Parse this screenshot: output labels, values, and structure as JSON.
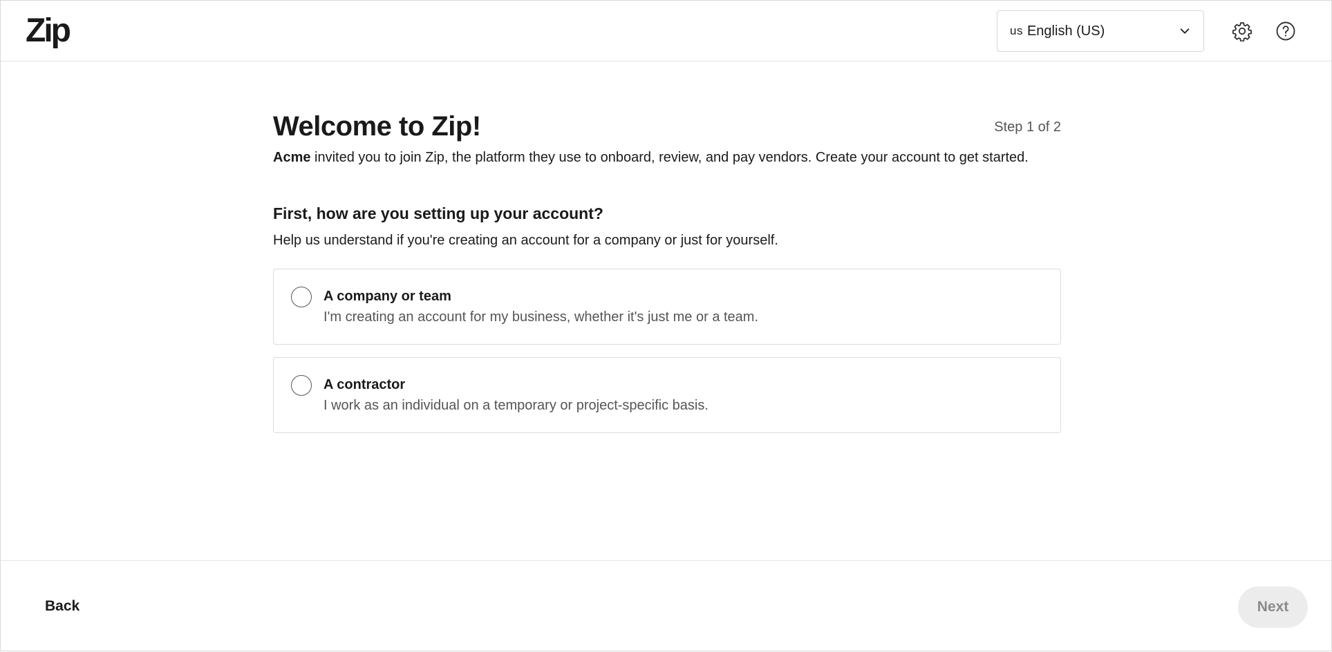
{
  "header": {
    "logo_text": "Zip",
    "language": {
      "flag": "us",
      "selected": "English (US)"
    },
    "settings_icon": "gear-icon",
    "help_icon": "question-circle-icon"
  },
  "main": {
    "title": "Welcome to Zip!",
    "step": "Step 1 of 2",
    "intro_company": "Acme",
    "intro_text": " invited you to join Zip, the platform they use to onboard, review, and pay vendors. Create your account to get started.",
    "question": "First, how are you setting up your account?",
    "question_help": "Help us understand if you're creating an account for a company or just for yourself.",
    "options": [
      {
        "title": "A company or team",
        "description": "I'm creating an account for my business, whether it's just me or a team.",
        "selected": false
      },
      {
        "title": "A contractor",
        "description": "I work as an individual on a temporary or project-specific basis.",
        "selected": false
      }
    ]
  },
  "footer": {
    "back_label": "Back",
    "next_label": "Next"
  },
  "colors": {
    "text": "#1a1a1a",
    "muted": "#555555",
    "border": "#dcdcdc",
    "disabled_bg": "#ececec",
    "disabled_text": "#8a8a8a"
  }
}
